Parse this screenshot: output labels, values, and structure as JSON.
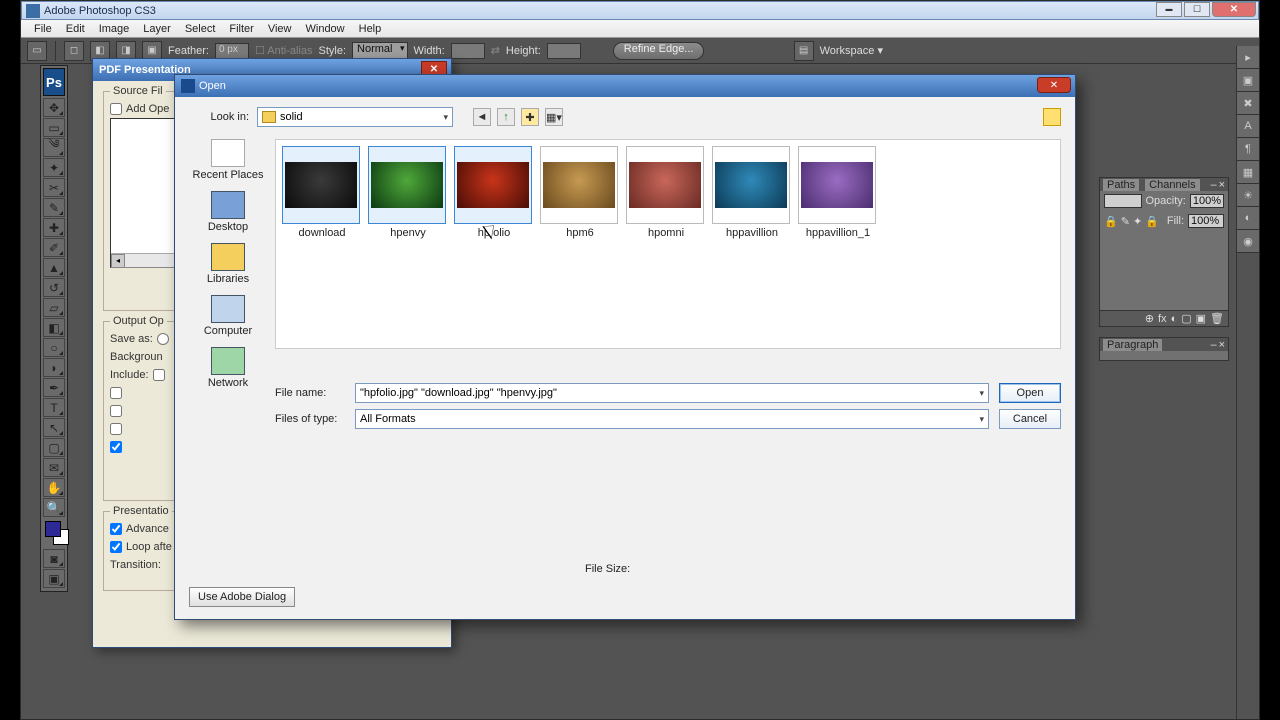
{
  "app": {
    "title": "Adobe Photoshop CS3"
  },
  "menu": [
    "File",
    "Edit",
    "Image",
    "Layer",
    "Select",
    "Filter",
    "View",
    "Window",
    "Help"
  ],
  "options_bar": {
    "feather_label": "Feather:",
    "feather_value": "0 px",
    "antialias": "Anti-alias",
    "style_label": "Style:",
    "style_value": "Normal",
    "width_label": "Width:",
    "height_label": "Height:",
    "refine": "Refine Edge...",
    "workspace": "Workspace ▾"
  },
  "right_panels": {
    "p1_tabs": [
      "Paths",
      "Channels"
    ],
    "p1_opacity": "100%",
    "p1_fill": "100%",
    "p2_tabs": [
      "Paragraph"
    ]
  },
  "pdf_dialog": {
    "title": "PDF Presentation",
    "group1": "Source Fil",
    "add_open": "Add Ope",
    "group2": "Output Op",
    "saveas": "Save as:",
    "background": "Backgroun",
    "include": "Include:",
    "group3": "Presentatio",
    "advance": "Advance",
    "loop": "Loop afte",
    "transition": "Transition:"
  },
  "open_dialog": {
    "title": "Open",
    "lookin_label": "Look in:",
    "lookin_value": "solid",
    "places": [
      {
        "key": "recent",
        "label": "Recent Places"
      },
      {
        "key": "desktop",
        "label": "Desktop"
      },
      {
        "key": "lib",
        "label": "Libraries"
      },
      {
        "key": "comp",
        "label": "Computer"
      },
      {
        "key": "net",
        "label": "Network"
      }
    ],
    "files": [
      {
        "name": "download",
        "color": "radial-gradient(circle at 50% 40%,#3a3a3a,#0b0b0b)",
        "selected": true
      },
      {
        "name": "hpenvy",
        "color": "radial-gradient(circle at 50% 40%,#4fa83a,#0c3a12)",
        "selected": true
      },
      {
        "name": "hpfolio",
        "color": "radial-gradient(circle at 50% 40%,#c8341a,#4a0d06)",
        "selected": true
      },
      {
        "name": "hpm6",
        "color": "radial-gradient(circle at 50% 40%,#c79a52,#6a4a1e)",
        "selected": false
      },
      {
        "name": "hpomni",
        "color": "radial-gradient(circle at 50% 40%,#c9675a,#6a2b24)",
        "selected": false
      },
      {
        "name": "hppavillion",
        "color": "radial-gradient(circle at 50% 40%,#2f8ab8,#0c3a56)",
        "selected": false
      },
      {
        "name": "hppavillion_1",
        "color": "radial-gradient(circle at 50% 40%,#9a6cc2,#4b2e70)",
        "selected": false
      }
    ],
    "filename_label": "File name:",
    "filename_value": "\"hpfolio.jpg\" \"download.jpg\" \"hpenvy.jpg\"",
    "filetype_label": "Files of type:",
    "filetype_value": "All Formats",
    "open_btn": "Open",
    "cancel_btn": "Cancel",
    "filesize_label": "File Size:",
    "adobe_dialog": "Use Adobe Dialog"
  }
}
